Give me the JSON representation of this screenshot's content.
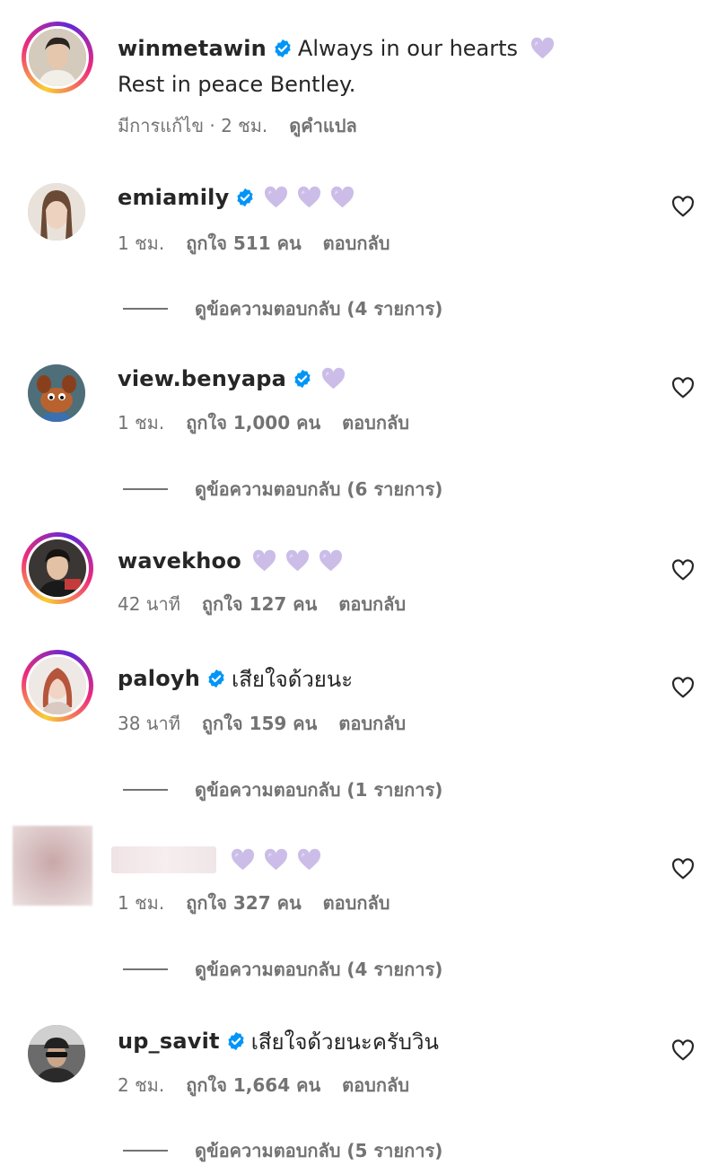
{
  "post": {
    "username": "winmetawin",
    "caption_line1": "Always in our hearts",
    "caption_line2": "Rest in peace Bentley.",
    "edited": "มีการแก้ไข · 2 ชม.",
    "translate": "ดูคำแปล"
  },
  "comments": [
    {
      "username": "emiamily",
      "verified": true,
      "text": "",
      "hearts": 3,
      "time": "1 ชม.",
      "likes": "ถูกใจ 511 คน",
      "reply": "ตอบกลับ",
      "view_replies": "ดูข้อความตอบกลับ (4 รายการ)",
      "avatar": "avatar-emiamily"
    },
    {
      "username": "view.benyapa",
      "verified": true,
      "text": "",
      "hearts": 1,
      "time": "1 ชม.",
      "likes": "ถูกใจ 1,000 คน",
      "reply": "ตอบกลับ",
      "view_replies": "ดูข้อความตอบกลับ (6 รายการ)",
      "avatar": "avatar-benyapa"
    },
    {
      "username": "wavekhoo",
      "verified": false,
      "text": "",
      "hearts": 3,
      "time": "42 นาที",
      "likes": "ถูกใจ 127 คน",
      "reply": "ตอบกลับ",
      "view_replies": "",
      "avatar": "avatar-wavekhoo"
    },
    {
      "username": "paloyh",
      "verified": true,
      "text": "เสียใจด้วยนะ",
      "hearts": 0,
      "time": "38 นาที",
      "likes": "ถูกใจ 159 คน",
      "reply": "ตอบกลับ",
      "view_replies": "ดูข้อความตอบกลับ (1 รายการ)",
      "avatar": "avatar-paloyh"
    },
    {
      "username": "",
      "verified": false,
      "text": "",
      "hearts": 3,
      "time": "1 ชม.",
      "likes": "ถูกใจ 327 คน",
      "reply": "ตอบกลับ",
      "view_replies": "ดูข้อความตอบกลับ (4 รายการ)",
      "avatar": "avatar-blurred"
    },
    {
      "username": "up_savit",
      "verified": true,
      "text": "เสียใจด้วยนะครับวิน",
      "hearts": 0,
      "time": "2 ชม.",
      "likes": "ถูกใจ 1,664 คน",
      "reply": "ตอบกลับ",
      "view_replies": "ดูข้อความตอบกลับ (5 รายการ)",
      "avatar": "avatar-upsavit"
    }
  ],
  "colors": {
    "verified_blue": "#0095f6",
    "heart_purple": "#cbbde8",
    "meta_gray": "#737373",
    "text_dark": "#262626"
  },
  "icons": {
    "verified": "verified-badge-icon",
    "heart": "purple-heart-emoji",
    "like": "heart-outline-icon"
  }
}
